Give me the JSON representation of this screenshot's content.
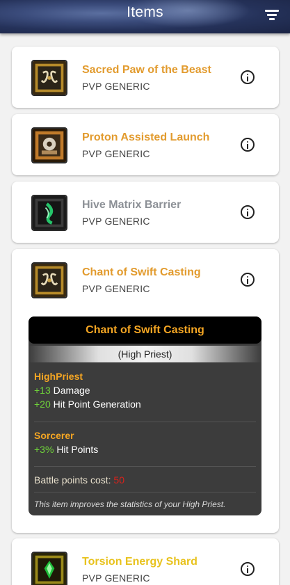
{
  "header": {
    "title": "Items"
  },
  "items": [
    {
      "name": "Sacred Paw of the Beast",
      "sub": "PVP GENERIC",
      "color": "#e29b2e"
    },
    {
      "name": "Proton Assisted Launch",
      "sub": "PVP GENERIC",
      "color": "#e29b2e"
    },
    {
      "name": "Hive Matrix Barrier",
      "sub": "PVP GENERIC",
      "color": "#8c9096"
    },
    {
      "name": "Chant of Swift Casting",
      "sub": "PVP GENERIC",
      "color": "#e29b2e"
    },
    {
      "name": "Torsion Energy Shard",
      "sub": "PVP GENERIC",
      "color": "#e8c21c"
    }
  ],
  "detail": {
    "title": "Chant of Swift Casting",
    "class_label": "(High Priest)",
    "groups": [
      {
        "title": "HighPriest",
        "stats": [
          {
            "value": "+13",
            "label": "Damage"
          },
          {
            "value": "+20",
            "label": "Hit Point Generation"
          }
        ]
      },
      {
        "title": "Sorcerer",
        "stats": [
          {
            "value": "+3%",
            "label": "Hit Points"
          }
        ]
      }
    ],
    "cost_label": "Battle points cost:",
    "cost_value": "50",
    "description": "This item improves the statistics of your High Priest."
  }
}
